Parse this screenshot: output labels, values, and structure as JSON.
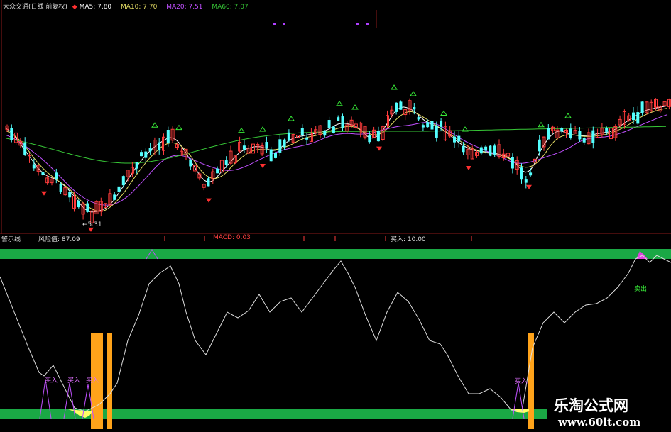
{
  "top_legend": {
    "stock_title": "大众交通(日线 前复权)",
    "ma5": "MA5: 7.80",
    "ma10": "MA10: 7.70",
    "ma20": "MA20: 7.51",
    "ma60": "MA60: 7.07"
  },
  "price_pane": {
    "low_marker": "←5.31"
  },
  "indicator_legend": {
    "name": "警示线",
    "risk": "风险值: 87.09",
    "macd": "MACD: 0.03",
    "buy": "买入: 10.00"
  },
  "annotations": {
    "buy1": "买入",
    "buy2": "买入",
    "buy3": "买入",
    "buy4": "买入",
    "sell": "卖出"
  },
  "watermark": {
    "line1": "乐淘公式网",
    "line2": "www.60lt.com"
  },
  "colors": {
    "up_candle": "#ff3c3c",
    "down_candle": "#54ffff",
    "ma5": "#ffffff",
    "ma10": "#e8e066",
    "ma20": "#c050ff",
    "ma60": "#37c837",
    "band": "#1aa845",
    "buy_bar": "#ffa31a",
    "risk_line": "#dddddd"
  }
}
